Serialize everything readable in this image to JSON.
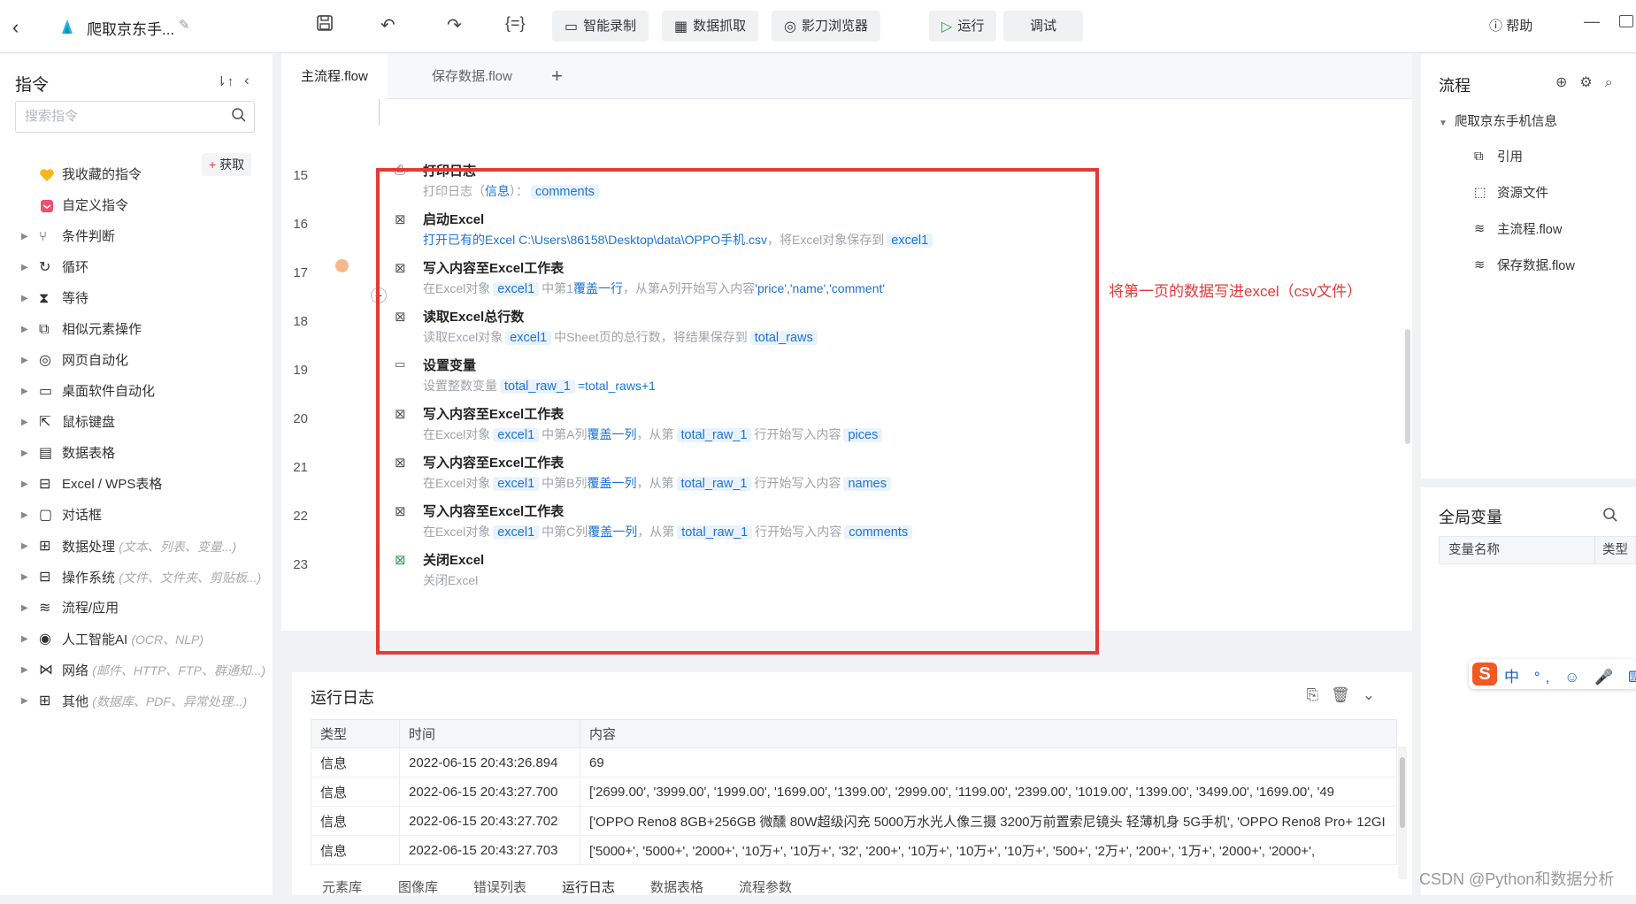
{
  "topbar": {
    "title": "爬取京东手...",
    "btn_record": "智能录制",
    "btn_capture": "数据抓取",
    "btn_browser": "影刀浏览器",
    "btn_run": "运行",
    "btn_debug": "调试",
    "help": "帮助"
  },
  "left": {
    "title": "指令",
    "search_placeholder": "搜索指令",
    "get_label": "获取",
    "items": [
      {
        "label": "我收藏的指令",
        "hint": ""
      },
      {
        "label": "自定义指令",
        "hint": ""
      },
      {
        "label": "条件判断",
        "hint": ""
      },
      {
        "label": "循环",
        "hint": ""
      },
      {
        "label": "等待",
        "hint": ""
      },
      {
        "label": "相似元素操作",
        "hint": ""
      },
      {
        "label": "网页自动化",
        "hint": ""
      },
      {
        "label": "桌面软件自动化",
        "hint": ""
      },
      {
        "label": "鼠标键盘",
        "hint": ""
      },
      {
        "label": "数据表格",
        "hint": ""
      },
      {
        "label": "Excel / WPS表格",
        "hint": ""
      },
      {
        "label": "对话框",
        "hint": ""
      },
      {
        "label": "数据处理",
        "hint": "(文本、列表、变量...)"
      },
      {
        "label": "操作系统",
        "hint": "(文件、文件夹、剪贴板...)"
      },
      {
        "label": "流程/应用",
        "hint": ""
      },
      {
        "label": "人工智能AI",
        "hint": "(OCR、NLP)"
      },
      {
        "label": "网络",
        "hint": "(邮件、HTTP、FTP、群通知...)"
      },
      {
        "label": "其他",
        "hint": "(数据库、PDF、异常处理...)"
      }
    ]
  },
  "editor": {
    "tab_main": "主流程.flow",
    "tab_save": "保存数据.flow",
    "annotation": "将第一页的数据写进excel（csv文件）",
    "line_numbers": [
      "15",
      "16",
      "17",
      "18",
      "19",
      "20",
      "21",
      "22",
      "23"
    ],
    "steps": [
      {
        "name": "打印日志",
        "d1": "打印日志（",
        "d2": "信息",
        "d3": "）：",
        "t1": "comments"
      },
      {
        "name": "启动Excel",
        "d1": "打开已有的Excel C:\\Users\\86158\\Desktop\\data\\OPPO手机.csv",
        "d2": "，将Excel对象保存到",
        "t1": "excel1"
      },
      {
        "name": "写入内容至Excel工作表",
        "d1": "在Excel对象",
        "t1": "excel1",
        "d2": "中第1",
        "d3": "覆盖一行",
        "d4": "，从第A列开始写入内容",
        "d5": "'price','name','comment'"
      },
      {
        "name": "读取Excel总行数",
        "d1": "读取Excel对象",
        "t1": "excel1",
        "d2": "中Sheet页的总行数，将结果保存到",
        "t2": "total_raws"
      },
      {
        "name": "设置变量",
        "d1": "设置整数变量",
        "t1": "total_raw_1",
        "d2": "=total_raws+1"
      },
      {
        "name": "写入内容至Excel工作表",
        "d1": "在Excel对象",
        "t1": "excel1",
        "d2": "中第A列",
        "d3": "覆盖一列",
        "d4": "，从第",
        "t2": "total_raw_1",
        "d5": "行开始写入内容",
        "t3": "pices"
      },
      {
        "name": "写入内容至Excel工作表",
        "d1": "在Excel对象",
        "t1": "excel1",
        "d2": "中第B列",
        "d3": "覆盖一列",
        "d4": "，从第",
        "t2": "total_raw_1",
        "d5": "行开始写入内容",
        "t3": "names"
      },
      {
        "name": "写入内容至Excel工作表",
        "d1": "在Excel对象",
        "t1": "excel1",
        "d2": "中第C列",
        "d3": "覆盖一列",
        "d4": "，从第",
        "t2": "total_raw_1",
        "d5": "行开始写入内容",
        "t3": "comments"
      },
      {
        "name": "关闭Excel",
        "d1": "关闭Excel"
      }
    ]
  },
  "log": {
    "title": "运行日志",
    "headers": [
      "类型",
      "时间",
      "内容"
    ],
    "rows": [
      {
        "type": "信息",
        "time": "2022-06-15 20:43:26.894",
        "content": "69"
      },
      {
        "type": "信息",
        "time": "2022-06-15 20:43:27.700",
        "content": "['2699.00', '3999.00', '1999.00', '1699.00', '1399.00', '2999.00', '1199.00', '2399.00', '1019.00', '1399.00', '3499.00', '1699.00', '49"
      },
      {
        "type": "信息",
        "time": "2022-06-15 20:43:27.702",
        "content": "['OPPO Reno8 8GB+256GB 微醺 80W超级闪充 5000万水光人像三摄 3200万前置索尼镜头 轻薄机身 5G手机', 'OPPO Reno8 Pro+ 12GI"
      },
      {
        "type": "信息",
        "time": "2022-06-15 20:43:27.703",
        "content": "['5000+', '5000+', '2000+', '10万+', '10万+', '32', '200+', '10万+', '10万+', '10万+', '500+', '2万+', '200+', '1万+', '2000+', '2000+',"
      }
    ],
    "tabs": [
      "元素库",
      "图像库",
      "错误列表",
      "运行日志",
      "数据表格",
      "流程参数"
    ]
  },
  "right": {
    "title": "流程",
    "tree_root": "爬取京东手机信息",
    "tree_items": [
      "引用",
      "资源文件",
      "主流程.flow",
      "保存数据.flow"
    ],
    "globals_title": "全局变量",
    "col_name": "变量名称",
    "col_type": "类型"
  },
  "ime_text": "中 °, ☺ 🎤 ⌨",
  "watermark": "CSDN @Python和数据分析"
}
